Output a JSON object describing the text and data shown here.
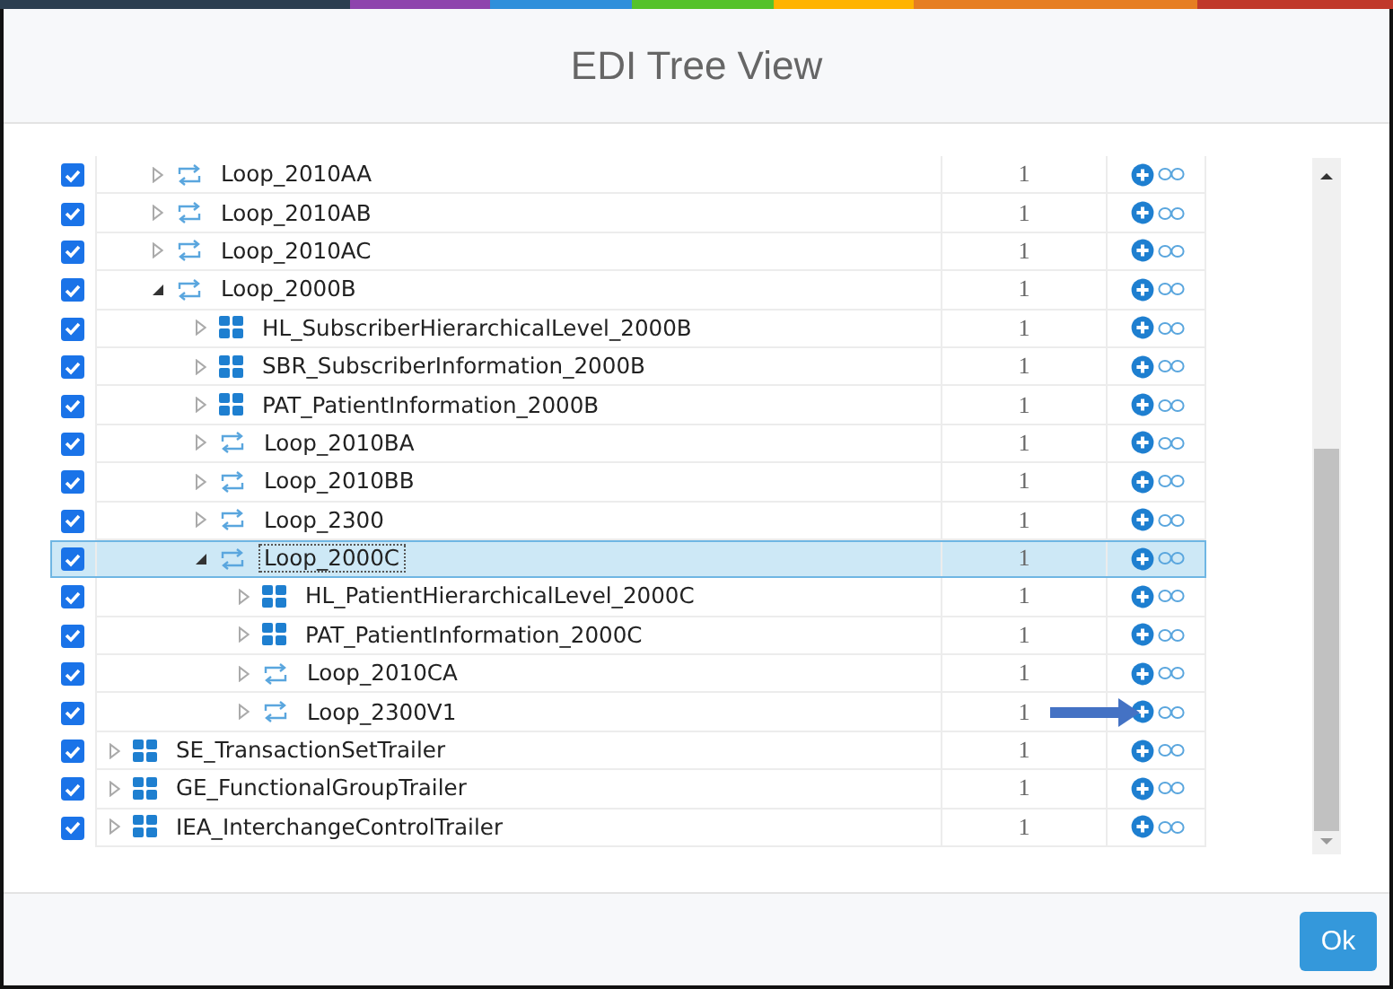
{
  "dialog": {
    "title": "EDI Tree View"
  },
  "tree": [
    {
      "children": [
        {
          "label": "Loop_2010AA",
          "kind": "loop",
          "checked": true,
          "expanded": false,
          "selected": false,
          "count": "1",
          "arrow": false
        },
        {
          "label": "Loop_2010AB",
          "kind": "loop",
          "checked": true,
          "expanded": false,
          "selected": false,
          "count": "1",
          "arrow": false
        },
        {
          "label": "Loop_2010AC",
          "kind": "loop",
          "checked": true,
          "expanded": false,
          "selected": false,
          "count": "1",
          "arrow": false
        },
        {
          "label": "Loop_2000B",
          "kind": "loop",
          "checked": true,
          "expanded": true,
          "selected": false,
          "count": "1",
          "arrow": false,
          "children": [
            {
              "label": "HL_SubscriberHierarchicalLevel_2000B",
              "kind": "segment",
              "checked": true,
              "expanded": false,
              "selected": false,
              "count": "1",
              "arrow": false
            },
            {
              "label": "SBR_SubscriberInformation_2000B",
              "kind": "segment",
              "checked": true,
              "expanded": false,
              "selected": false,
              "count": "1",
              "arrow": false
            },
            {
              "label": "PAT_PatientInformation_2000B",
              "kind": "segment",
              "checked": true,
              "expanded": false,
              "selected": false,
              "count": "1",
              "arrow": false
            },
            {
              "label": "Loop_2010BA",
              "kind": "loop",
              "checked": true,
              "expanded": false,
              "selected": false,
              "count": "1",
              "arrow": false
            },
            {
              "label": "Loop_2010BB",
              "kind": "loop",
              "checked": true,
              "expanded": false,
              "selected": false,
              "count": "1",
              "arrow": false
            },
            {
              "label": "Loop_2300",
              "kind": "loop",
              "checked": true,
              "expanded": false,
              "selected": false,
              "count": "1",
              "arrow": false
            },
            {
              "label": "Loop_2000C",
              "kind": "loop",
              "checked": true,
              "expanded": true,
              "selected": true,
              "count": "1",
              "arrow": false,
              "children": [
                {
                  "label": "HL_PatientHierarchicalLevel_2000C",
                  "kind": "segment",
                  "checked": true,
                  "expanded": false,
                  "selected": false,
                  "count": "1",
                  "arrow": false
                },
                {
                  "label": "PAT_PatientInformation_2000C",
                  "kind": "segment",
                  "checked": true,
                  "expanded": false,
                  "selected": false,
                  "count": "1",
                  "arrow": false
                },
                {
                  "label": "Loop_2010CA",
                  "kind": "loop",
                  "checked": true,
                  "expanded": false,
                  "selected": false,
                  "count": "1",
                  "arrow": false
                },
                {
                  "label": "Loop_2300V1",
                  "kind": "loop",
                  "checked": true,
                  "expanded": false,
                  "selected": false,
                  "count": "1",
                  "arrow": true
                }
              ]
            }
          ]
        }
      ]
    },
    {
      "label": "SE_TransactionSetTrailer",
      "kind": "segment",
      "checked": true,
      "expanded": false,
      "selected": false,
      "count": "1",
      "arrow": false
    },
    {
      "label": "GE_FunctionalGroupTrailer",
      "kind": "segment",
      "checked": true,
      "expanded": false,
      "selected": false,
      "count": "1",
      "arrow": false
    },
    {
      "label": "IEA_InterchangeControlTrailer",
      "kind": "segment",
      "checked": true,
      "expanded": false,
      "selected": false,
      "count": "1",
      "arrow": false
    }
  ],
  "buttons": [
    {
      "label": "Ok"
    }
  ]
}
